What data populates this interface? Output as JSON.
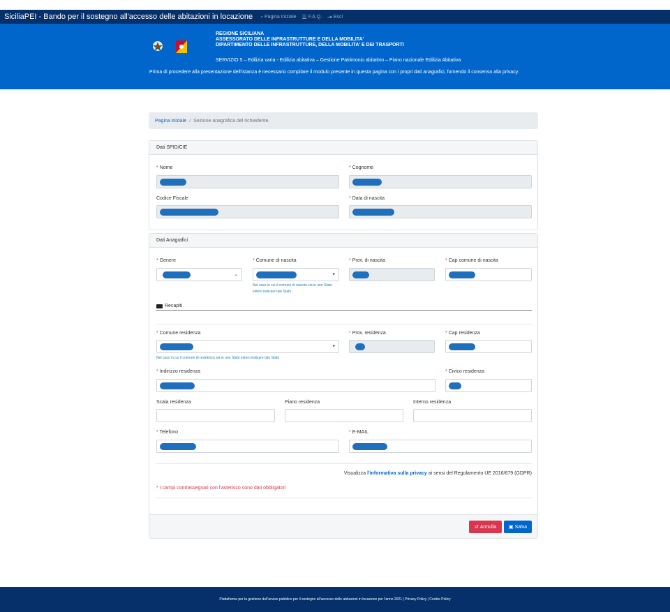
{
  "nav": {
    "brand": "SiciliaPEI - Bando per il sostegno all'accesso delle abitazioni in locazione",
    "links": [
      {
        "icon": "dashboard-icon",
        "label": "Pagina Iniziale"
      },
      {
        "icon": "list-icon",
        "label": "F.A.Q."
      },
      {
        "icon": "sign-out-icon",
        "label": "Esci"
      }
    ]
  },
  "hero": {
    "logos": [
      "emblem-icon",
      "trinacria-icon"
    ],
    "org_lines": [
      "REGIONE SICILIANA",
      "ASSESSORATO DELLE INFRASTRUTTURE E DELLA MOBILITA'",
      "DIPARTIMENTO DELLE INFRASTRUTTURE, DELLA MOBILITA' E DEI TRASPORTI"
    ],
    "servizio": "SERVIZIO 5 – Edilizia varia - Edilizia abitativa – Gestione Patrimonio abitativo – Piano nazionale Edilizia Abitativa",
    "intro": "Prima di procedere alla presentazione dell'istanza è necessario compilare il modulo presente in questa pagina con i propri dati anagrafici, fornendo il consenso alla privacy."
  },
  "breadcrumb": {
    "home": "Pagina iniziale",
    "separator": "/",
    "current": "Sezione anagrafica del richiedente."
  },
  "spid": {
    "title": "Dati SPID/CIE",
    "nome_label": "Nome",
    "cognome_label": "Cognome",
    "cf_label": "Codice Fiscale",
    "nascita_label": "Data di nascita"
  },
  "anagrafici": {
    "title": "Dati Anagrafici",
    "genere_label": "Genere",
    "comune_nascita_label": "Comune di nascita",
    "prov_nascita_label": "Prov. di nascita",
    "cap_nascita_label": "Cap comune di nascita",
    "help_nascita": "Nel caso in cui il comune di nascita sia in uno Stato estero indicare tale Stato",
    "recapiti_title": "Recapiti",
    "comune_res_label": "Comune residenza",
    "prov_res_label": "Prov. residenza",
    "cap_res_label": "Cap residenza",
    "help_res": "Nel caso in cui il comune di residenza sia in uno Stato estero indicare tale Stato",
    "indirizzo_label": "Indirizzo residenza",
    "civico_label": "Civico residenza",
    "scala_label": "Scala residenza",
    "piano_label": "Piano residenza",
    "interno_label": "Interno residenza",
    "telefono_label": "Telefono",
    "email_label": "E-MAIL",
    "required_mark": "*",
    "privacy_pre": "Visualizza ",
    "privacy_link": "l'informativa sulla privacy",
    "privacy_post": " ai sensi del Regolamento UE 2016/679 (GDPR)",
    "mandatory_note": "* I campi contrassegnati con l'asterisco sono dati obbligatori",
    "cancel_label": "Annulla",
    "save_label": "Salva"
  },
  "footer": {
    "text": "Piattaforma per la gestione dell'avviso pubblico per il sostegno all'accesso delle abitazioni in locazione per l'anno 2021 | Privacy Policy | Cookie Policy"
  }
}
